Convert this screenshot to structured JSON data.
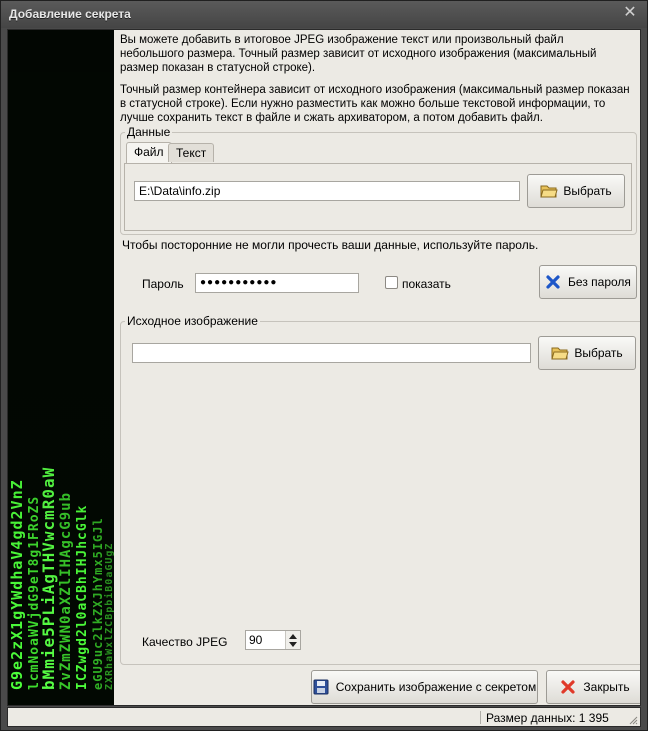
{
  "window": {
    "title": "Добавление секрета",
    "close_glyph": "✕"
  },
  "intro": {
    "paragraph1": "Вы можете добавить в итоговое JPEG изображение текст или произвольный файл небольшого размера. Точный размер зависит от исходного изображения (максимальный размер показан в статусной строке).",
    "paragraph2": "Точный размер контейнера зависит от исходного изображения (максимальный размер показан в статусной строке). Если нужно разместить как можно больше текстовой информации, то лучше сохранить текст в файле и сжать архиватором, а потом добавить файл."
  },
  "data_group": {
    "label": "Данные",
    "tabs": [
      {
        "label": "Файл",
        "active": true
      },
      {
        "label": "Текст",
        "active": false
      }
    ],
    "file_path": "E:\\Data\\info.zip",
    "browse_label": "Выбрать"
  },
  "password": {
    "hint": "Чтобы посторонние не могли прочесть ваши данные, используйте пароль.",
    "label": "Пароль",
    "masked_value": "●●●●●●●●●●●",
    "show_label": "показать",
    "show_checked": false,
    "no_password_label": "Без пароля"
  },
  "source_group": {
    "label": "Исходное изображение",
    "path": "",
    "browse_label": "Выбрать"
  },
  "quality": {
    "label": "Качество JPEG",
    "value": "90"
  },
  "actions": {
    "save_label": "Сохранить изображение с секретом",
    "close_label": "Закрыть"
  },
  "status": {
    "text": "Размер данных: 1 395"
  },
  "icons": {
    "folder": "folder-open-icon",
    "no_password": "red-x-icon",
    "save": "floppy-disk-icon",
    "close": "red-x-icon"
  },
  "colors": {
    "matrix_green": "#4cff3a",
    "background": "#eceae4",
    "titlebar": "#4a4a4a"
  }
}
